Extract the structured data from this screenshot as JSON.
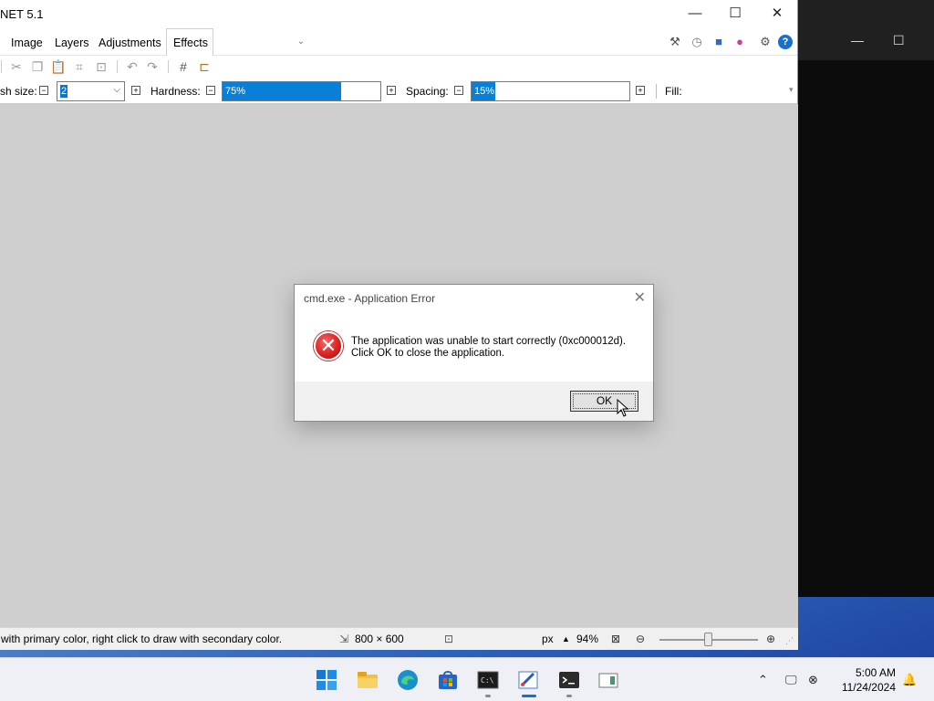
{
  "window": {
    "title": "NET 5.1"
  },
  "menu": {
    "items": [
      "Image",
      "Layers",
      "Adjustments",
      "Effects"
    ]
  },
  "toolbar": {
    "brush_size_label": "sh size:",
    "brush_size_value": "2",
    "hardness_label": "Hardness:",
    "hardness_value": "75%",
    "hardness_level": 0.75,
    "spacing_label": "Spacing:",
    "spacing_value": "15%",
    "spacing_level": 0.15,
    "fill_label": "Fill:"
  },
  "status": {
    "hint": "with primary color, right click to draw with secondary color.",
    "image_size": "800 × 600",
    "unit": "px",
    "zoom": "94%"
  },
  "dialog": {
    "title": "cmd.exe - Application Error",
    "line1": "The application was unable to start correctly (0xc000012d).",
    "line2": "Click OK to close the application.",
    "ok_label": "OK"
  },
  "taskbar": {
    "time": "5:00 AM",
    "date": "11/24/2024"
  }
}
